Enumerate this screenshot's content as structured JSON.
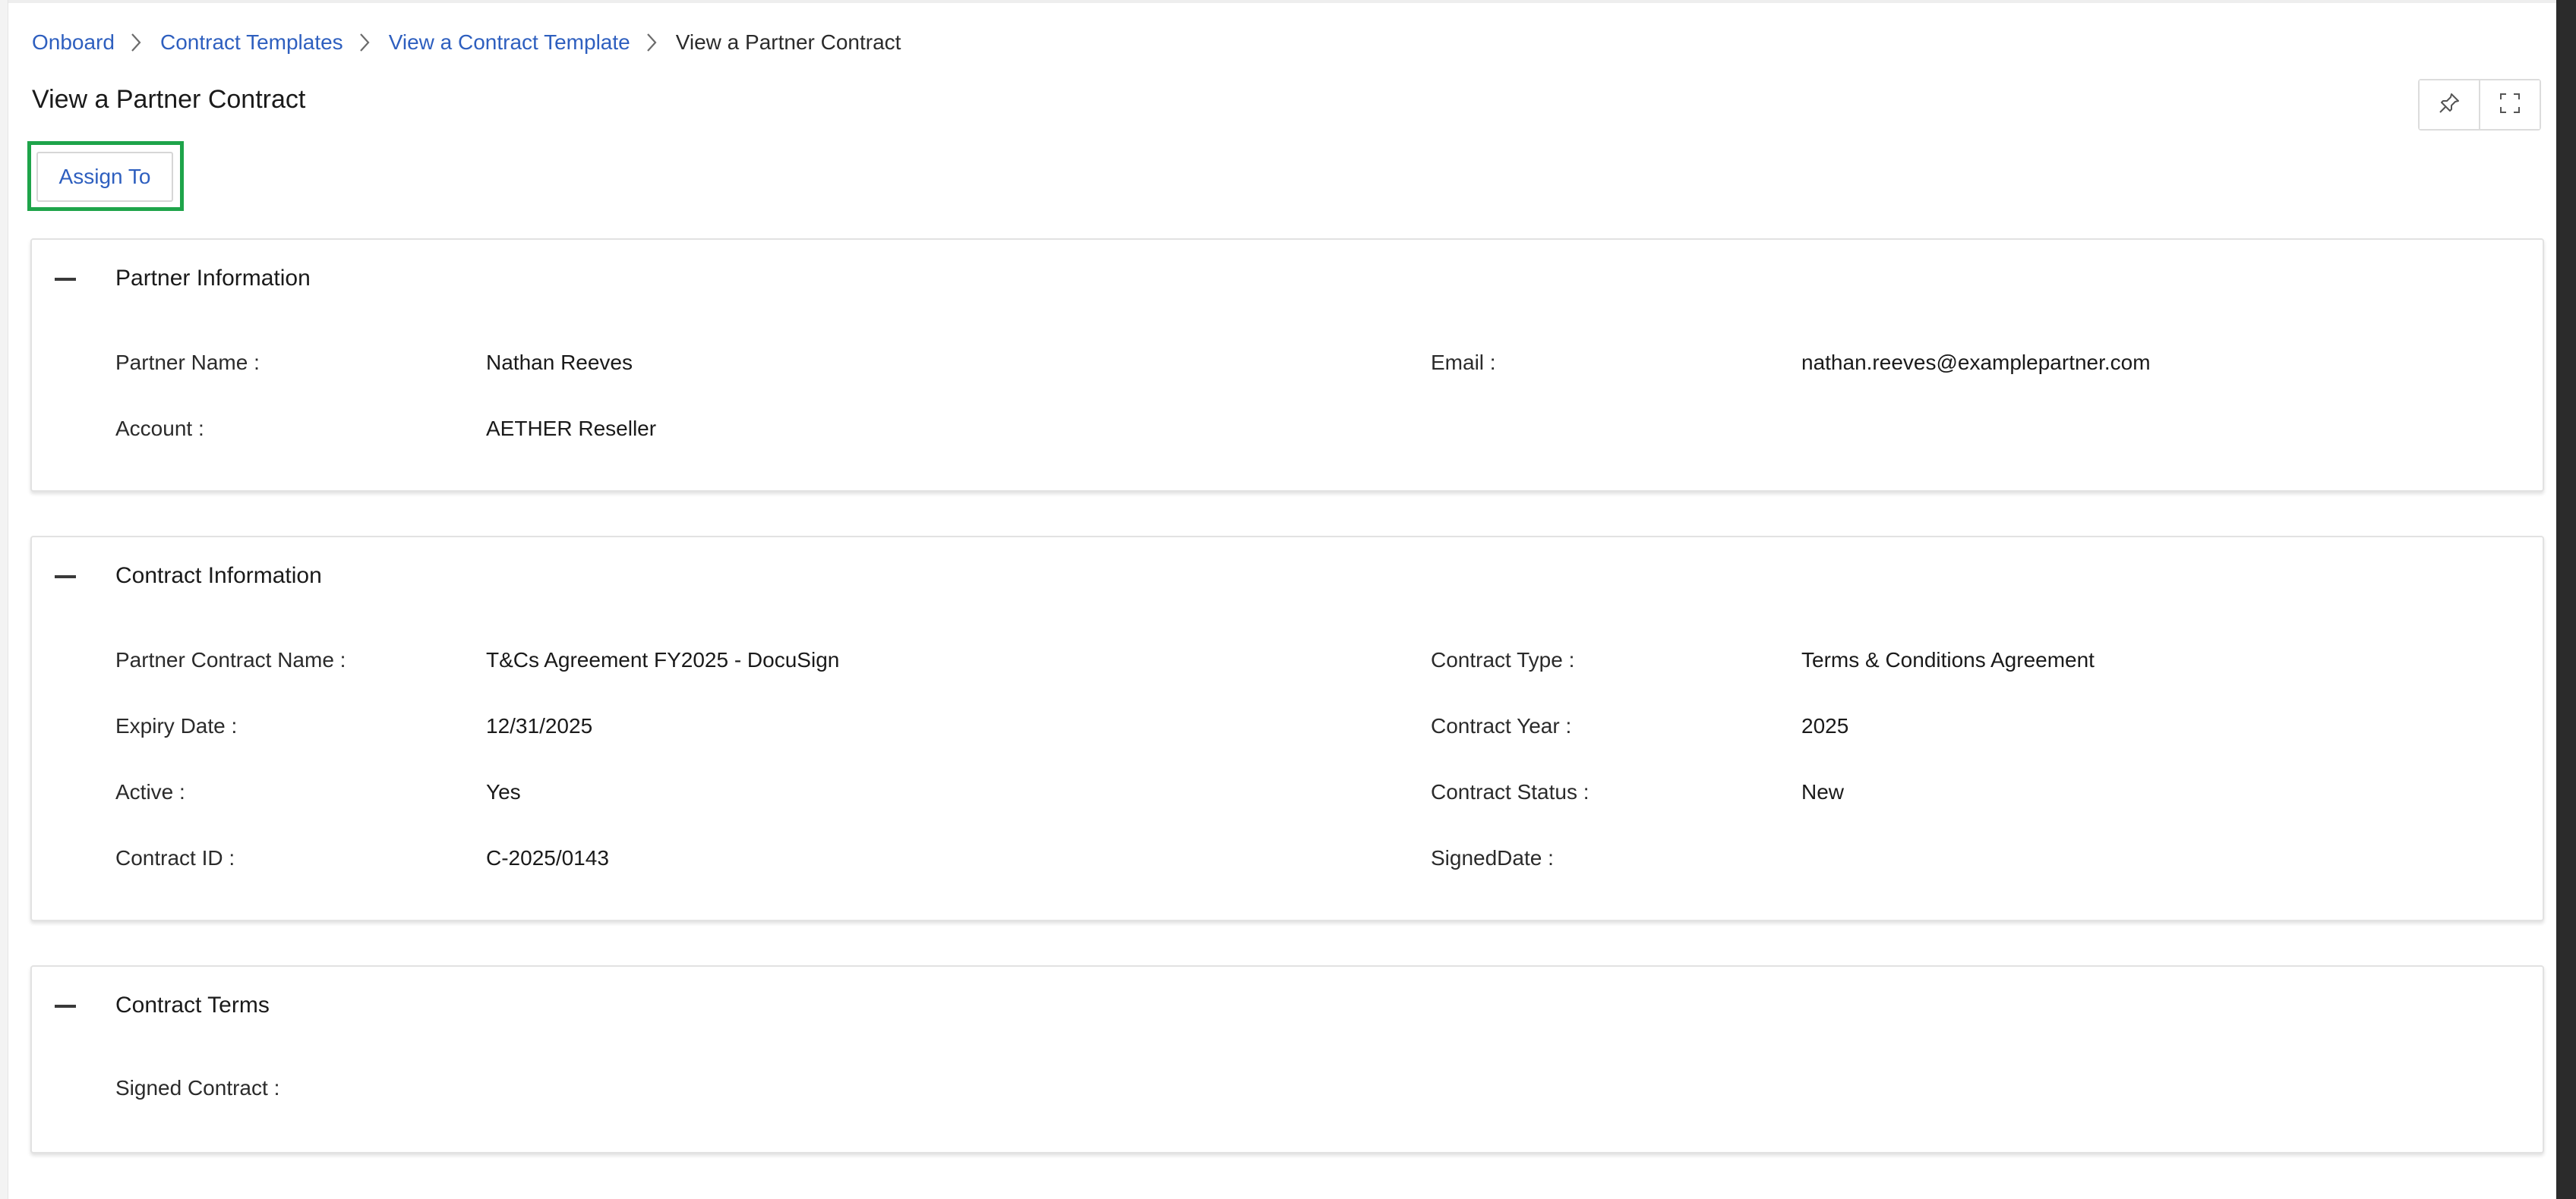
{
  "breadcrumb": {
    "items": [
      {
        "label": "Onboard"
      },
      {
        "label": "Contract Templates"
      },
      {
        "label": "View a Contract Template"
      }
    ],
    "current": "View a Partner Contract"
  },
  "page": {
    "title": "View a Partner Contract"
  },
  "toolbar": {
    "assign_label": "Assign To",
    "pin_icon": "pin-icon",
    "fullscreen_icon": "fullscreen-icon"
  },
  "partner_info": {
    "title": "Partner Information",
    "fields": {
      "partner_name": {
        "label": "Partner Name :",
        "value": "Nathan Reeves"
      },
      "email": {
        "label": "Email :",
        "value": "nathan.reeves@examplepartner.com"
      },
      "account": {
        "label": "Account :",
        "value": "AETHER Reseller"
      }
    }
  },
  "contract_info": {
    "title": "Contract Information",
    "fields": {
      "contract_name": {
        "label": "Partner Contract Name :",
        "value": "T&Cs Agreement FY2025 - DocuSign"
      },
      "contract_type": {
        "label": "Contract Type :",
        "value": "Terms & Conditions Agreement"
      },
      "expiry_date": {
        "label": "Expiry Date :",
        "value": "12/31/2025"
      },
      "contract_year": {
        "label": "Contract Year :",
        "value": "2025"
      },
      "active": {
        "label": "Active :",
        "value": "Yes"
      },
      "contract_status": {
        "label": "Contract Status :",
        "value": "New"
      },
      "contract_id": {
        "label": "Contract ID :",
        "value": "C-2025/0143"
      },
      "signed_date": {
        "label": "SignedDate :",
        "value": ""
      }
    }
  },
  "contract_terms": {
    "title": "Contract Terms",
    "fields": {
      "signed_contract": {
        "label": "Signed Contract :",
        "value": ""
      }
    }
  },
  "colors": {
    "link": "#2e5fbf",
    "highlight": "#1ea44a",
    "border": "#e2e2e2"
  }
}
